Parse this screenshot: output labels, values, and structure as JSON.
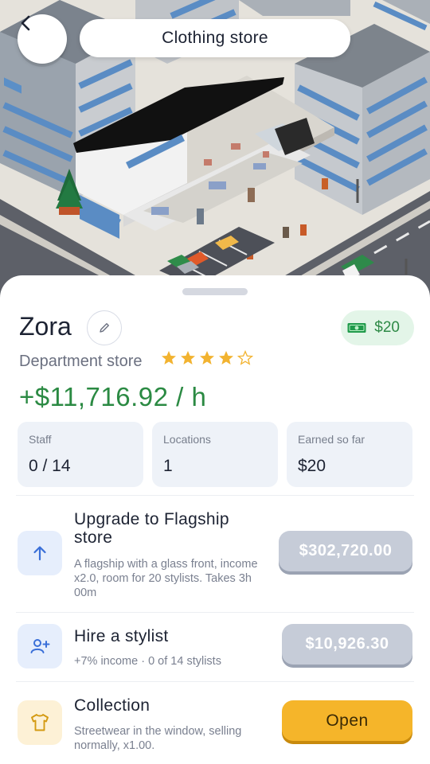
{
  "header": {
    "title": "Clothing store"
  },
  "store": {
    "name": "Zora",
    "type": "Department store",
    "rating": 4,
    "rating_max": 5,
    "income": "+$11,716.92 / h",
    "cash": "$20"
  },
  "stats": [
    {
      "label": "Staff",
      "value": "0 / 14"
    },
    {
      "label": "Locations",
      "value": "1"
    },
    {
      "label": "Earned so far",
      "value": "$20"
    }
  ],
  "actions": [
    {
      "title": "Upgrade to Flagship store",
      "description": "A flagship with a glass front, income x2.0, room for 20 stylists. Takes 3h 00m",
      "button": "$302,720.00",
      "icon": "arrow-up-icon"
    },
    {
      "title": "Hire a stylist",
      "description": "+7% income · 0 of 14 stylists",
      "button": "$10,926.30",
      "icon": "add-user-icon"
    },
    {
      "title": "Collection",
      "description": "Streetwear in the window, selling normally, x1.00.",
      "button": "Open",
      "icon": "tshirt-icon"
    }
  ],
  "colors": {
    "income_green": "#2b8a43",
    "gold_button": "#f5b52a",
    "disabled_button": "#c6ccd8",
    "star": "#f2b330"
  }
}
